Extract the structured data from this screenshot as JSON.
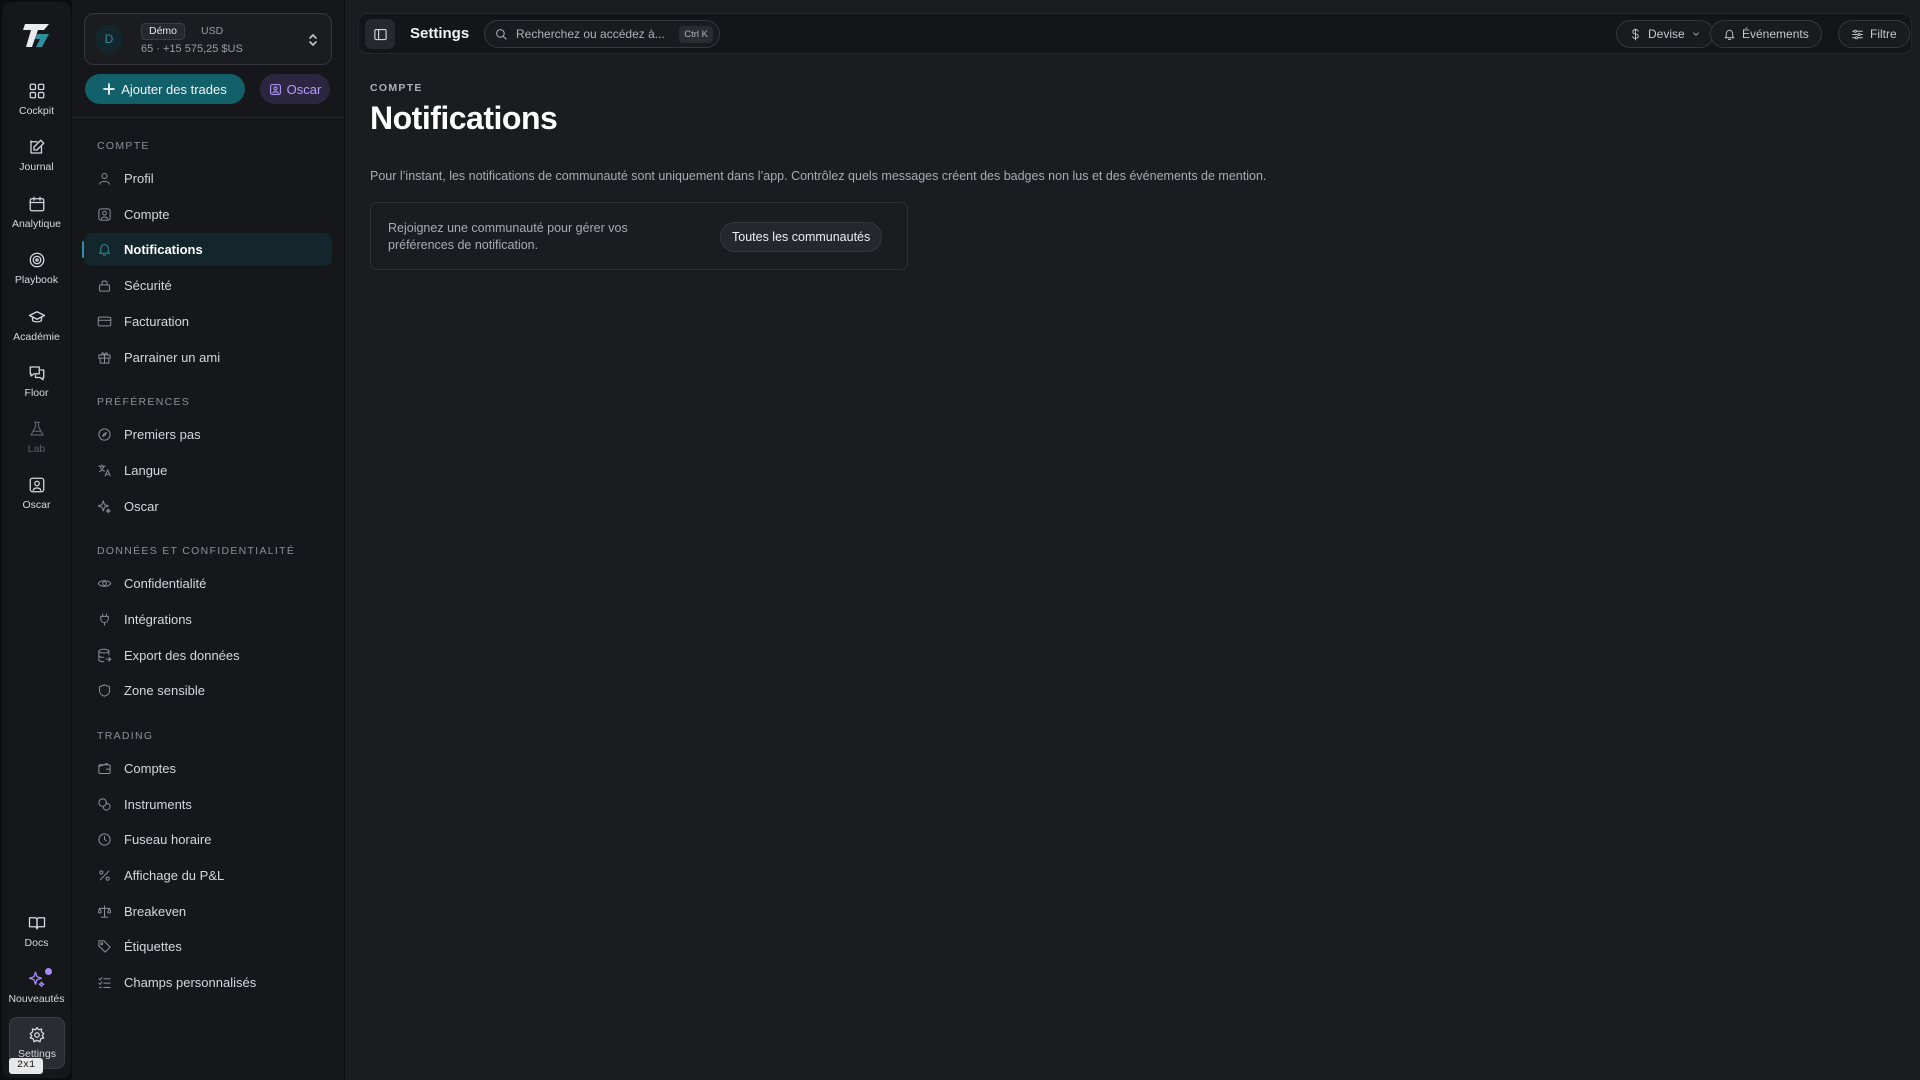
{
  "rail": {
    "items": [
      {
        "label": "Cockpit"
      },
      {
        "label": "Journal"
      },
      {
        "label": "Analytique"
      },
      {
        "label": "Playbook"
      },
      {
        "label": "Académie"
      },
      {
        "label": "Floor"
      },
      {
        "label": "Lab"
      },
      {
        "label": "Oscar"
      },
      {
        "label": "Docs"
      },
      {
        "label": "Nouveautés"
      },
      {
        "label": "Settings"
      }
    ],
    "badge": "2x1"
  },
  "account": {
    "avatar": "D",
    "tag": "Démo",
    "currency": "USD",
    "stats": "65 · +15 575,25 $US"
  },
  "actions": {
    "add_trades": "Ajouter des trades",
    "oscar": "Oscar"
  },
  "sidebar": {
    "sections": [
      {
        "title": "COMPTE",
        "items": [
          {
            "label": "Profil"
          },
          {
            "label": "Compte"
          },
          {
            "label": "Notifications"
          },
          {
            "label": "Sécurité"
          },
          {
            "label": "Facturation"
          },
          {
            "label": "Parrainer un ami"
          }
        ]
      },
      {
        "title": "PRÉFÉRENCES",
        "items": [
          {
            "label": "Premiers pas"
          },
          {
            "label": "Langue"
          },
          {
            "label": "Oscar"
          }
        ]
      },
      {
        "title": "DONNÉES ET CONFIDENTIALITÉ",
        "items": [
          {
            "label": "Confidentialité"
          },
          {
            "label": "Intégrations"
          },
          {
            "label": "Export des données"
          },
          {
            "label": "Zone sensible"
          }
        ]
      },
      {
        "title": "TRADING",
        "items": [
          {
            "label": "Comptes"
          },
          {
            "label": "Instruments"
          },
          {
            "label": "Fuseau horaire"
          },
          {
            "label": "Affichage du P&L"
          },
          {
            "label": "Breakeven"
          },
          {
            "label": "Étiquettes"
          },
          {
            "label": "Champs personnalisés"
          }
        ]
      }
    ]
  },
  "topbar": {
    "title": "Settings",
    "search_placeholder": "Recherchez ou accédez à...",
    "search_shortcut": "Ctrl K",
    "devise": "Devise",
    "evenements": "Événements",
    "filtre": "Filtre"
  },
  "page": {
    "eyebrow": "COMPTE",
    "title": "Notifications",
    "description": "Pour l’instant, les notifications de communauté sont uniquement dans l’app. Contrôlez quels messages créent des badges non lus et des événements de mention.",
    "card_text": "Rejoignez une communauté pour gérer vos préférences de notification.",
    "card_button": "Toutes les communautés"
  },
  "colors": {
    "accent_teal": "#11606a",
    "accent_violet": "#b39dff",
    "background": "#1b1c20"
  }
}
